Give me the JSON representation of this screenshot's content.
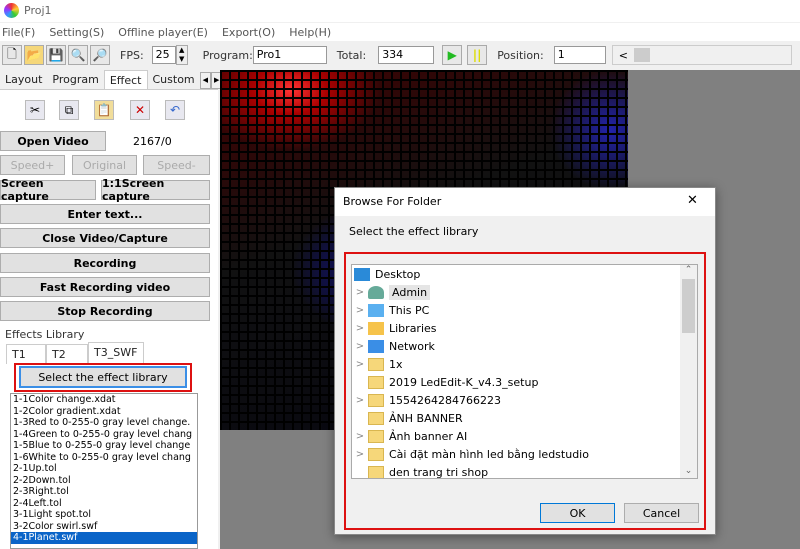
{
  "window": {
    "title": "Proj1"
  },
  "menu": [
    "File(F)",
    "Setting(S)",
    "Offline player(E)",
    "Export(O)",
    "Help(H)"
  ],
  "toolbar": {
    "fps_label": "FPS:",
    "fps_value": "25",
    "program_label": "Program:",
    "program_value": "Pro1",
    "total_label": "Total:",
    "total_value": "334",
    "position_label": "Position:",
    "position_value": "1",
    "scroll_left": "<"
  },
  "tabs": [
    "Layout",
    "Program",
    "Effect",
    "Custom"
  ],
  "active_tab": "Effect",
  "panel": {
    "open_video": "Open Video",
    "frame_count": "2167/0",
    "speed_plus": "Speed+",
    "original": "Original",
    "speed_minus": "Speed-",
    "screen_capture": "Screen capture",
    "screen_capture_11": "1:1Screen capture",
    "enter_text": "Enter text...",
    "close_video": "Close Video/Capture",
    "recording": "Recording",
    "fast_recording": "Fast Recording video",
    "stop_recording": "Stop Recording"
  },
  "effects_library": {
    "label": "Effects Library",
    "tabs": [
      "T1",
      "T2",
      "T3_SWF"
    ],
    "select_button": "Select the effect library",
    "items": [
      "1-1Color change.xdat",
      "1-2Color gradient.xdat",
      "1-3Red to 0-255-0 gray level change.",
      "1-4Green to 0-255-0 gray level chang",
      "1-5Blue to 0-255-0 gray level change",
      "1-6White to 0-255-0 gray level chang",
      "2-1Up.tol",
      "2-2Down.tol",
      "2-3Right.tol",
      "2-4Left.tol",
      "3-1Light spot.tol",
      "3-2Color swirl.swf",
      "4-1Planet.swf"
    ],
    "selected": "4-1Planet.swf"
  },
  "dialog": {
    "title": "Browse For Folder",
    "close": "✕",
    "prompt": "Select the effect library",
    "ok": "OK",
    "cancel": "Cancel",
    "tree": [
      {
        "label": "Desktop",
        "icon": "desktop-icon",
        "expander": ""
      },
      {
        "label": "Admin",
        "icon": "user-icon",
        "expander": ">"
      },
      {
        "label": "This PC",
        "icon": "computer-icon",
        "expander": ">"
      },
      {
        "label": "Libraries",
        "icon": "libraries-icon",
        "expander": ">"
      },
      {
        "label": "Network",
        "icon": "network-icon",
        "expander": ">"
      },
      {
        "label": "1x",
        "icon": "folder-icon",
        "expander": ">"
      },
      {
        "label": "2019 LedEdit-K_v4.3_setup",
        "icon": "folder-icon",
        "expander": ""
      },
      {
        "label": "1554264284766223",
        "icon": "folder-icon",
        "expander": ">"
      },
      {
        "label": "ẢNH BANNER",
        "icon": "folder-icon",
        "expander": ""
      },
      {
        "label": "Ảnh banner AI",
        "icon": "folder-icon",
        "expander": ">"
      },
      {
        "label": "Cài đặt màn hình led bằng ledstudio",
        "icon": "folder-icon",
        "expander": ">"
      },
      {
        "label": "den trang tri shop",
        "icon": "folder-icon",
        "expander": ""
      }
    ]
  },
  "colors": {
    "highlight": "#d11111",
    "selection": "#0a64c8"
  }
}
